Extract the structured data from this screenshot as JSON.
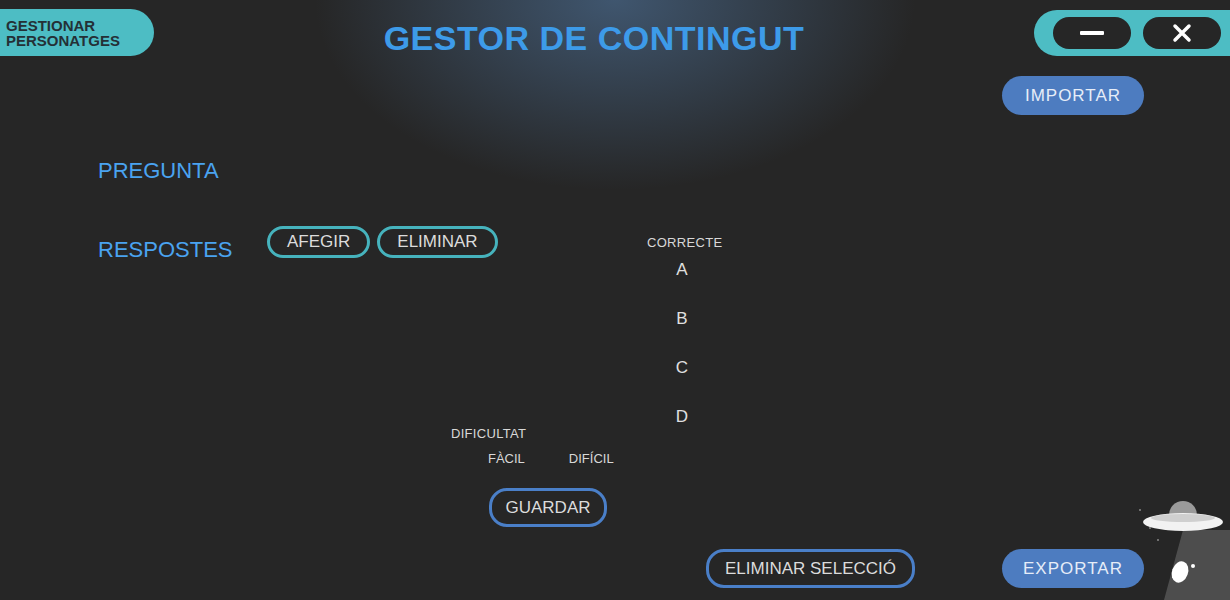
{
  "window": {
    "title": "GESTOR DE CONTINGUT"
  },
  "nav_button": "GESTIONAR PERSONATGES",
  "import_button": "IMPORTAR",
  "question": {
    "label": "PREGUNTA"
  },
  "answers": {
    "label": "RESPOSTES",
    "buttons": [
      "AFEGIR",
      "ELIMINAR"
    ]
  },
  "correct": {
    "label": "CORRECTE",
    "options": [
      "A",
      "B",
      "C",
      "D"
    ]
  },
  "difficulty": {
    "label": "DIFICULTAT",
    "options": [
      "FÀCIL",
      "DIFÍCIL"
    ]
  },
  "save_button": "GUARDAR",
  "footer_buttons": [
    "ELIMINAR SELECCIÓ"
  ],
  "export_button": "EXPORTAR"
}
